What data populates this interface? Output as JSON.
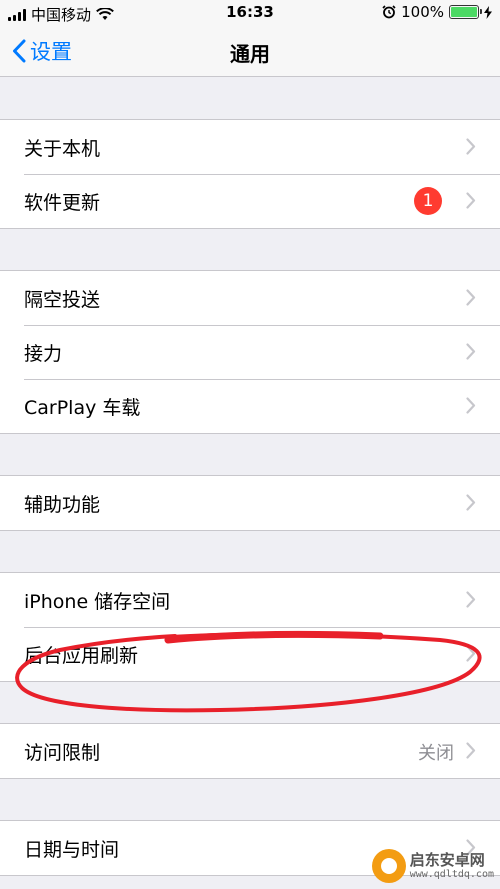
{
  "status_bar": {
    "carrier": "中国移动",
    "time": "16:33",
    "battery": "100%"
  },
  "nav": {
    "back_label": "设置",
    "title": "通用"
  },
  "groups": [
    {
      "rows": [
        {
          "label": "关于本机"
        },
        {
          "label": "软件更新",
          "badge": "1"
        }
      ]
    },
    {
      "rows": [
        {
          "label": "隔空投送"
        },
        {
          "label": "接力"
        },
        {
          "label": "CarPlay 车载"
        }
      ]
    },
    {
      "rows": [
        {
          "label": "辅助功能"
        }
      ]
    },
    {
      "rows": [
        {
          "label": "iPhone 储存空间"
        },
        {
          "label": "后台应用刷新"
        }
      ]
    },
    {
      "rows": [
        {
          "label": "访问限制",
          "value": "关闭"
        }
      ]
    },
    {
      "rows": [
        {
          "label": "日期与时间"
        }
      ]
    }
  ],
  "watermark": {
    "name": "启东安卓网",
    "url": "www.qdltdq.com"
  },
  "colors": {
    "accent": "#007aff",
    "badge": "#ff3b30",
    "annotation": "#e8202a",
    "battery": "#4cd964"
  }
}
